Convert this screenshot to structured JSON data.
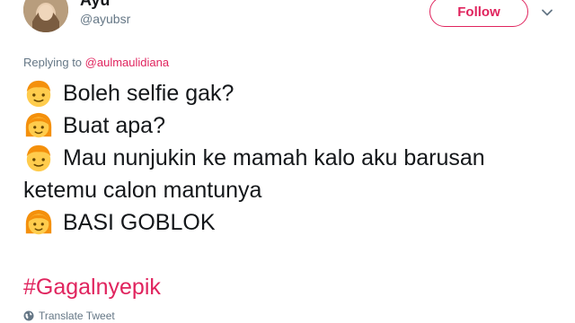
{
  "tweet": {
    "author": {
      "display_name": "Ayu",
      "handle": "@ayubsr"
    },
    "follow_label": "Follow",
    "replying_to_label": "Replying to",
    "replying_to_handle": "@aulmaulidiana",
    "lines": [
      {
        "emoji": "boy-emoji",
        "text": "Boleh selfie gak?"
      },
      {
        "emoji": "girl-emoji",
        "text": "Buat apa?"
      },
      {
        "emoji": "boy-emoji",
        "text": "Mau nunjukin ke mamah kalo aku barusan"
      },
      {
        "emoji": null,
        "text": "ketemu calon mantunya"
      },
      {
        "emoji": "girl-emoji",
        "text": "BASI GOBLOK"
      }
    ],
    "hashtag": "#Gagalnyepik",
    "translate_label": "Translate Tweet"
  },
  "colors": {
    "accent": "#e0245e",
    "secondary_text": "#657786",
    "primary_text": "#14171a",
    "emoji_yellow": "#ffcc4d"
  }
}
